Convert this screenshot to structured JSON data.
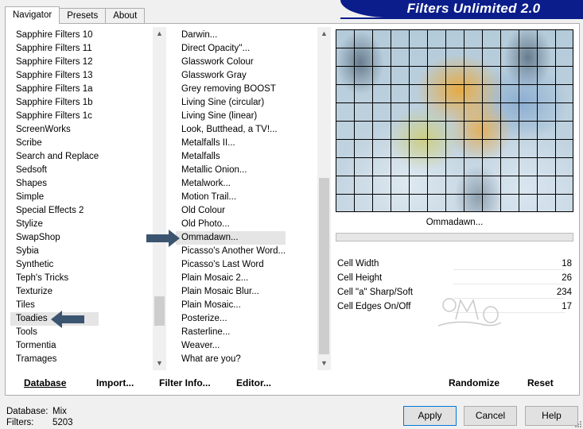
{
  "app": {
    "title": "Filters Unlimited 2.0"
  },
  "tabs": [
    {
      "label": "Navigator",
      "active": true
    },
    {
      "label": "Presets",
      "active": false
    },
    {
      "label": "About",
      "active": false
    }
  ],
  "categories": {
    "items": [
      "Sapphire Filters 10",
      "Sapphire Filters 11",
      "Sapphire Filters 12",
      "Sapphire Filters 13",
      "Sapphire Filters 1a",
      "Sapphire Filters 1b",
      "Sapphire Filters 1c",
      "ScreenWorks",
      "Scribe",
      "Search and Replace",
      "Sedsoft",
      "Shapes",
      "Simple",
      "Special Effects 2",
      "Stylize",
      "SwapShop",
      "Sybia",
      "Synthetic",
      "Teph's Tricks",
      "Texturize",
      "Tiles",
      "Toadies",
      "Tools",
      "Tormentia",
      "Tramages"
    ],
    "selected": "Toadies"
  },
  "filters": {
    "items": [
      "Darwin...",
      "Direct Opacity''...",
      "Glasswork Colour",
      "Glasswork Gray",
      "Grey removing BOOST",
      "Living Sine (circular)",
      "Living Sine (linear)",
      "Look, Butthead, a TV!...",
      "Metalfalls II...",
      "Metalfalls",
      "Metallic Onion...",
      "Metalwork...",
      "Motion Trail...",
      "Old Colour",
      "Old Photo...",
      "Ommadawn...",
      "Picasso's Another Word...",
      "Picasso's Last Word",
      "Plain Mosaic 2...",
      "Plain Mosaic Blur...",
      "Plain Mosaic...",
      "Posterize...",
      "Rasterline...",
      "Weaver...",
      "What are you?"
    ],
    "selected": "Ommadawn..."
  },
  "preview": {
    "filter_name": "Ommadawn..."
  },
  "parameters": [
    {
      "name": "Cell Width",
      "value": "18"
    },
    {
      "name": "Cell Height",
      "value": "26"
    },
    {
      "name": "Cell \"a\" Sharp/Soft",
      "value": "234"
    },
    {
      "name": "Cell Edges On/Off",
      "value": "17"
    }
  ],
  "toolbar": {
    "database": "Database",
    "import": "Import...",
    "filter_info": "Filter Info...",
    "editor": "Editor...",
    "randomize": "Randomize",
    "reset": "Reset"
  },
  "status": {
    "database_label": "Database:",
    "database_value": "Mix",
    "filters_label": "Filters:",
    "filters_value": "5203"
  },
  "buttons": {
    "apply": "Apply",
    "cancel": "Cancel",
    "help": "Help"
  },
  "colors": {
    "banner": "#0b1d8a",
    "pointer_arrow": "#3b5570",
    "selection": "#e5e5e5"
  }
}
